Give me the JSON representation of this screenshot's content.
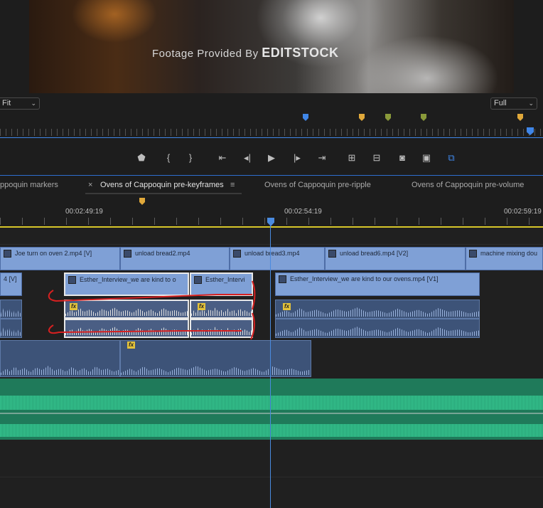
{
  "program_monitor": {
    "watermark_prefix": "Footage Provided By ",
    "watermark_brand": "EDITSTOCK",
    "fit_select": "Fit",
    "resolution_select": "Full"
  },
  "marker_colors": {
    "blue": "#3f86e8",
    "yellow": "#e0a83a",
    "green": "#8a9a3a"
  },
  "transport": {
    "buttons": [
      "add-marker",
      "mark-in",
      "mark-out",
      "go-to-in",
      "step-back",
      "play",
      "step-forward",
      "go-to-out",
      "lift",
      "extract",
      "export-frame",
      "comparison-view",
      "proxy-toggle"
    ]
  },
  "sequence_tabs": [
    {
      "label": "ppoquin markers"
    },
    {
      "label": "Ovens of Cappoquin pre-keyframes",
      "active": true
    },
    {
      "label": "Ovens of Cappoquin pre-ripple"
    },
    {
      "label": "Ovens of Cappoquin pre-volume"
    }
  ],
  "timecodes": [
    "00:02:49:19",
    "00:02:54:19",
    "00:02:59:19"
  ],
  "tracks": {
    "v2_clips": [
      "Joe turn on oven 2.mp4 [V]",
      "unload bread2.mp4",
      "unload bread3.mp4",
      "unload bread6.mp4 [V2]",
      "machine mixing dou"
    ],
    "v1_clips": [
      "4 [V]",
      "Esther_Interview_we are kind to o",
      "Esther_Intervi",
      "Esther_Interview_we are kind to our ovens.mp4 [V1]"
    ],
    "fx_label": "fx"
  }
}
